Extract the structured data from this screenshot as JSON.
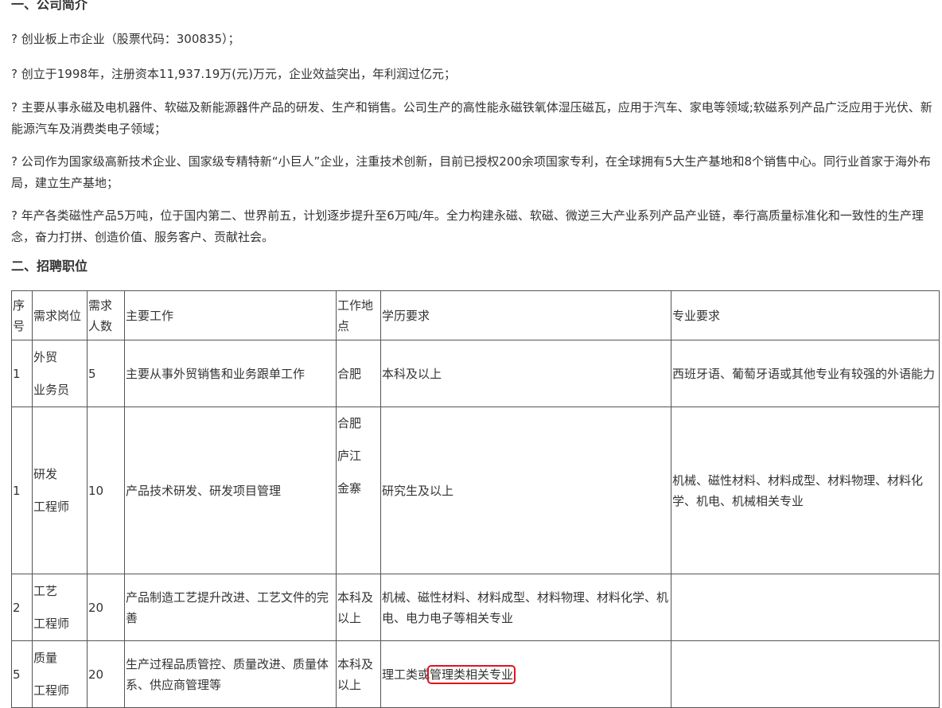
{
  "intro": {
    "heading": "一、公司简介",
    "paragraphs": [
      "? 创业板上市企业（股票代码：300835）；",
      "? 创立于1998年，注册资本11,937.19万(元)万元，企业效益突出，年利润过亿元；",
      "? 主要从事永磁及电机器件、软磁及新能源器件产品的研发、生产和销售。公司生产的高性能永磁铁氧体湿压磁瓦，应用于汽车、家电等领域;软磁系列产品广泛应用于光伏、新能源汽车及消费类电子领域；",
      "? 公司作为国家级高新技术企业、国家级专精特新“小巨人”企业，注重技术创新，目前已授权200余项国家专利，在全球拥有5大生产基地和8个销售中心。同行业首家于海外布局，建立生产基地；",
      "? 年产各类磁性产品5万吨，位于国内第二、世界前五，计划逐步提升至6万吨/年。全力构建永磁、软磁、微逆三大产业系列产品产业链，奉行高质量标准化和一致性的生产理念，奋力打拼、创造价值、服务客户、贡献社会。"
    ]
  },
  "recruit": {
    "heading": "二、招聘职位",
    "columns": {
      "seq": [
        "序",
        "号"
      ],
      "position": "需求岗位",
      "count": [
        "需求",
        "人数"
      ],
      "duties": "主要工作",
      "location": [
        "工作地",
        "点"
      ],
      "education": "学历要求",
      "major": "专业要求"
    },
    "rows": [
      {
        "seq": "1",
        "position": [
          "外贸",
          "业务员"
        ],
        "count": "5",
        "duties": "主要从事外贸销售和业务跟单工作",
        "location": [
          "合肥"
        ],
        "education": "本科及以上",
        "major": "西班牙语、葡萄牙语或其他专业有较强的外语能力"
      },
      {
        "seq": "1",
        "position": [
          "研发",
          "工程师"
        ],
        "count": "10",
        "duties": "产品技术研发、研发项目管理",
        "location": [
          "合肥",
          "庐江",
          "金寨"
        ],
        "education": "研究生及以上",
        "major": "机械、磁性材料、材料成型、材料物理、材料化学、机电、机械相关专业"
      },
      {
        "seq": "2",
        "position": [
          "工艺",
          "工程师"
        ],
        "count": "20",
        "duties": "产品制造工艺提升改进、工艺文件的完善",
        "location": [
          "本科及",
          "以上"
        ],
        "education": "机械、磁性材料、材料成型、材料物理、材料化学、机电、电力电子等相关专业",
        "major": ""
      },
      {
        "seq": "5",
        "position": [
          "质量",
          "工程师"
        ],
        "count": "20",
        "duties": "生产过程品质管控、质量改进、质量体系、供应商管理等",
        "location": [
          "本科及",
          "以上"
        ],
        "education_prefix": "理工类或",
        "education_highlight": "管理类相关专业",
        "major": ""
      }
    ]
  },
  "colors": {
    "text": "#333333",
    "border": "#555555",
    "highlight": "#e0141e"
  }
}
